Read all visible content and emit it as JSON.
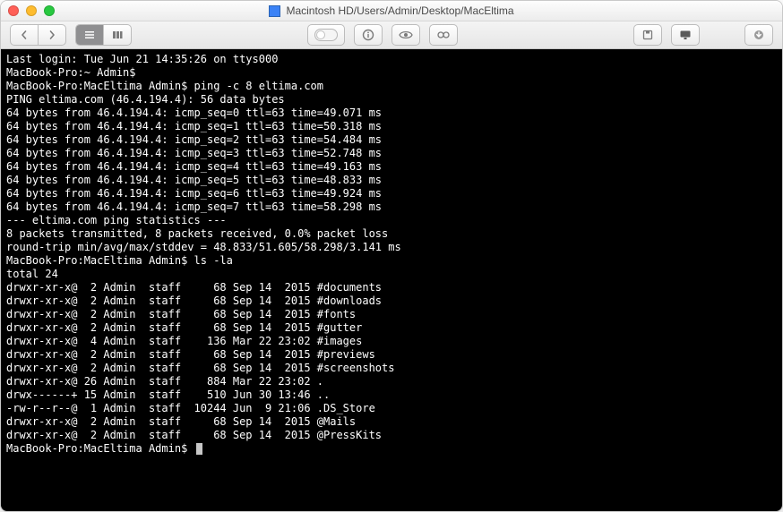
{
  "window": {
    "title": "Macintosh HD/Users/Admin/Desktop/MacEltima"
  },
  "terminal": {
    "last_login": "Last login: Tue Jun 21 14:35:26 on ttys000",
    "prompt_home": "MacBook-Pro:~ Admin$",
    "prompt_dir": "MacBook-Pro:MacEltima Admin$",
    "cmd_ping": "ping -c 8 eltima.com",
    "ping_header": "PING eltima.com (46.4.194.4): 56 data bytes",
    "ping_lines": [
      "64 bytes from 46.4.194.4: icmp_seq=0 ttl=63 time=49.071 ms",
      "64 bytes from 46.4.194.4: icmp_seq=1 ttl=63 time=50.318 ms",
      "64 bytes from 46.4.194.4: icmp_seq=2 ttl=63 time=54.484 ms",
      "64 bytes from 46.4.194.4: icmp_seq=3 ttl=63 time=52.748 ms",
      "64 bytes from 46.4.194.4: icmp_seq=4 ttl=63 time=49.163 ms",
      "64 bytes from 46.4.194.4: icmp_seq=5 ttl=63 time=48.833 ms",
      "64 bytes from 46.4.194.4: icmp_seq=6 ttl=63 time=49.924 ms",
      "64 bytes from 46.4.194.4: icmp_seq=7 ttl=63 time=58.298 ms"
    ],
    "stats_hdr": "--- eltima.com ping statistics ---",
    "stats_l1": "8 packets transmitted, 8 packets received, 0.0% packet loss",
    "stats_l2": "round-trip min/avg/max/stddev = 48.833/51.605/58.298/3.141 ms",
    "cmd_ls": "ls -la",
    "total": "total 24",
    "ls_rows": [
      {
        "perm": "drwxr-xr-x@",
        "links": " 2",
        "owner": "Admin",
        "group": "staff",
        "size": "    68",
        "date": "Sep 14  2015",
        "name": "#documents"
      },
      {
        "perm": "drwxr-xr-x@",
        "links": " 2",
        "owner": "Admin",
        "group": "staff",
        "size": "    68",
        "date": "Sep 14  2015",
        "name": "#downloads"
      },
      {
        "perm": "drwxr-xr-x@",
        "links": " 2",
        "owner": "Admin",
        "group": "staff",
        "size": "    68",
        "date": "Sep 14  2015",
        "name": "#fonts"
      },
      {
        "perm": "drwxr-xr-x@",
        "links": " 2",
        "owner": "Admin",
        "group": "staff",
        "size": "    68",
        "date": "Sep 14  2015",
        "name": "#gutter"
      },
      {
        "perm": "drwxr-xr-x@",
        "links": " 4",
        "owner": "Admin",
        "group": "staff",
        "size": "   136",
        "date": "Mar 22 23:02",
        "name": "#images"
      },
      {
        "perm": "drwxr-xr-x@",
        "links": " 2",
        "owner": "Admin",
        "group": "staff",
        "size": "    68",
        "date": "Sep 14  2015",
        "name": "#previews"
      },
      {
        "perm": "drwxr-xr-x@",
        "links": " 2",
        "owner": "Admin",
        "group": "staff",
        "size": "    68",
        "date": "Sep 14  2015",
        "name": "#screenshots"
      },
      {
        "perm": "drwxr-xr-x@",
        "links": "26",
        "owner": "Admin",
        "group": "staff",
        "size": "   884",
        "date": "Mar 22 23:02",
        "name": "."
      },
      {
        "perm": "drwx------+",
        "links": "15",
        "owner": "Admin",
        "group": "staff",
        "size": "   510",
        "date": "Jun 30 13:46",
        "name": ".."
      },
      {
        "perm": "-rw-r--r--@",
        "links": " 1",
        "owner": "Admin",
        "group": "staff",
        "size": " 10244",
        "date": "Jun  9 21:06",
        "name": ".DS_Store"
      },
      {
        "perm": "drwxr-xr-x@",
        "links": " 2",
        "owner": "Admin",
        "group": "staff",
        "size": "    68",
        "date": "Sep 14  2015",
        "name": "@Mails"
      },
      {
        "perm": "drwxr-xr-x@",
        "links": " 2",
        "owner": "Admin",
        "group": "staff",
        "size": "    68",
        "date": "Sep 14  2015",
        "name": "@PressKits"
      }
    ]
  }
}
